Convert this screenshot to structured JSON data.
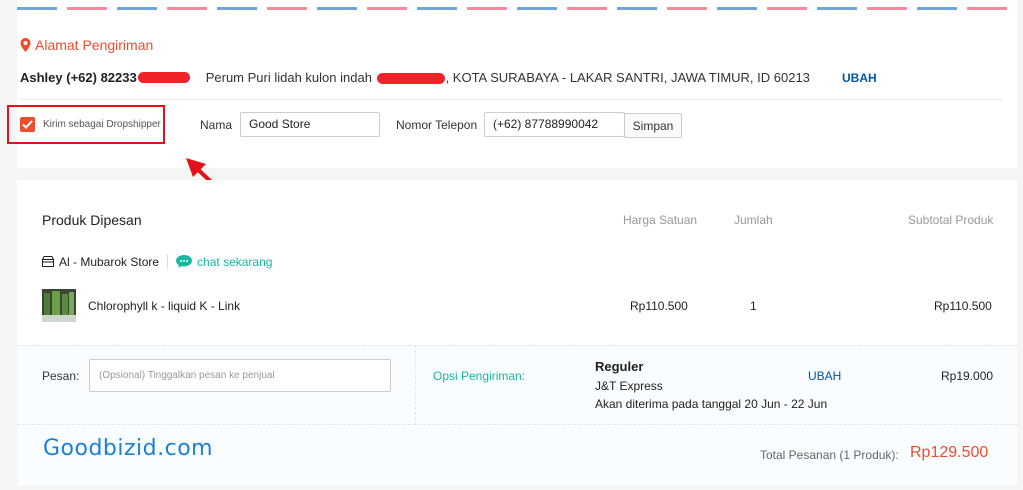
{
  "colors": {
    "accent": "#ee4d2d",
    "link": "#0055aa",
    "teal": "#17b8a0",
    "highlight": "#e5101a"
  },
  "address": {
    "title": "Alamat Pengiriman",
    "buyer": "Ashley (+62) 82233",
    "line_start": "Perum Puri lidah kulon indah",
    "line_end": ", KOTA SURABAYA - LAKAR SANTRI, JAWA TIMUR, ID 60213",
    "change_label": "UBAH"
  },
  "dropship": {
    "checkbox_label": "Kirim sebagai Dropshipper",
    "checked": true,
    "name_label": "Nama",
    "name_value": "Good Store",
    "phone_label": "Nomor Telepon",
    "phone_value": "(+62) 87788990042",
    "save_label": "Simpan"
  },
  "order": {
    "title": "Produk Dipesan",
    "columns": {
      "unit_price": "Harga Satuan",
      "qty": "Jumlah",
      "subtotal": "Subtotal Produk"
    },
    "shop": {
      "name": "Al - Mubarok Store",
      "chat_label": "chat sekarang"
    },
    "items": [
      {
        "name": "Chlorophyll k - liquid K - Link",
        "unit_price": "Rp110.500",
        "qty": "1",
        "subtotal": "Rp110.500"
      }
    ]
  },
  "message": {
    "label": "Pesan:",
    "placeholder": "(Opsional) Tinggalkan pesan ke penjual"
  },
  "shipping": {
    "label": "Opsi Pengiriman:",
    "service": "Reguler",
    "courier": "J&T Express",
    "eta": "Akan diterima pada tanggal 20 Jun - 22 Jun",
    "change_label": "UBAH",
    "cost": "Rp19.000"
  },
  "total": {
    "label": "Total Pesanan (1 Produk):",
    "value": "Rp129.500"
  },
  "watermark": "Goodbizid.com"
}
